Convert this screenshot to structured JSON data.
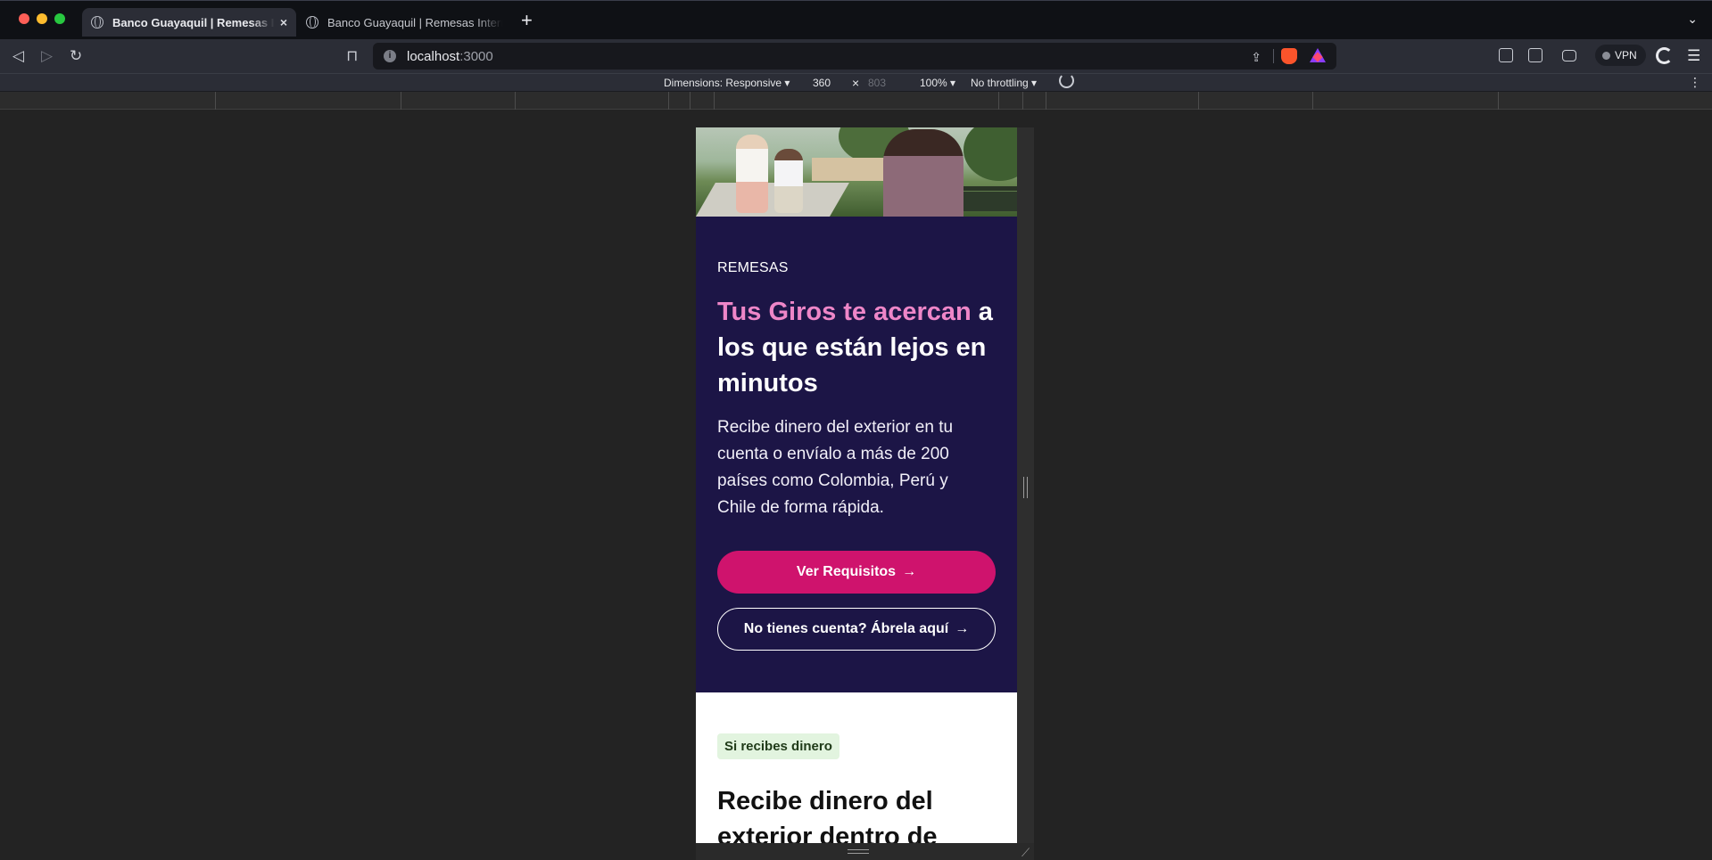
{
  "browser": {
    "tabs": [
      {
        "title": "Banco Guayaquil | Remesas Internacionales",
        "active": true
      },
      {
        "title": "Banco Guayaquil | Remesas Internacionales",
        "active": false
      }
    ],
    "new_tab_label": "+",
    "close_label": "×",
    "tab_menu_label": "⌄",
    "url_host": "localhost",
    "url_port": ":3000",
    "vpn_label": "VPN",
    "icons": [
      "back-icon",
      "forward-icon",
      "reload-icon",
      "bookmark-icon",
      "share-icon",
      "brave-shields-icon",
      "rewards-icon",
      "extensions-icon",
      "sidebar-icon",
      "wallet-icon",
      "leo-icon",
      "menu-icon"
    ]
  },
  "devtools": {
    "dimensions_label": "Dimensions: Responsive ▾",
    "width_value": "360",
    "height_value": "803",
    "times_label": "×",
    "zoom_label": "100% ▾",
    "throttle_label": "No throttling ▾",
    "more_label": "⋮"
  },
  "page": {
    "eyebrow": "REMESAS",
    "headline_highlight": "Tus Giros te acercan",
    "headline_rest": " a los que están lejos en minutos",
    "description": "Recibe dinero del exterior en tu cuenta o envíalo a más de 200 países como Colombia, Perú y Chile de forma rápida.",
    "primary_button": "Ver Requisitos",
    "secondary_button": "No tienes cuenta? Ábrela aquí",
    "arrow": "→",
    "section_tag": "Si recibes dinero",
    "section_title": "Recibe dinero del exterior dentro de"
  },
  "colors": {
    "hero_background": "#1c1546",
    "headline_accent": "#ee86c8",
    "primary_button": "#cf136d",
    "tag_background": "#e2f4df"
  }
}
